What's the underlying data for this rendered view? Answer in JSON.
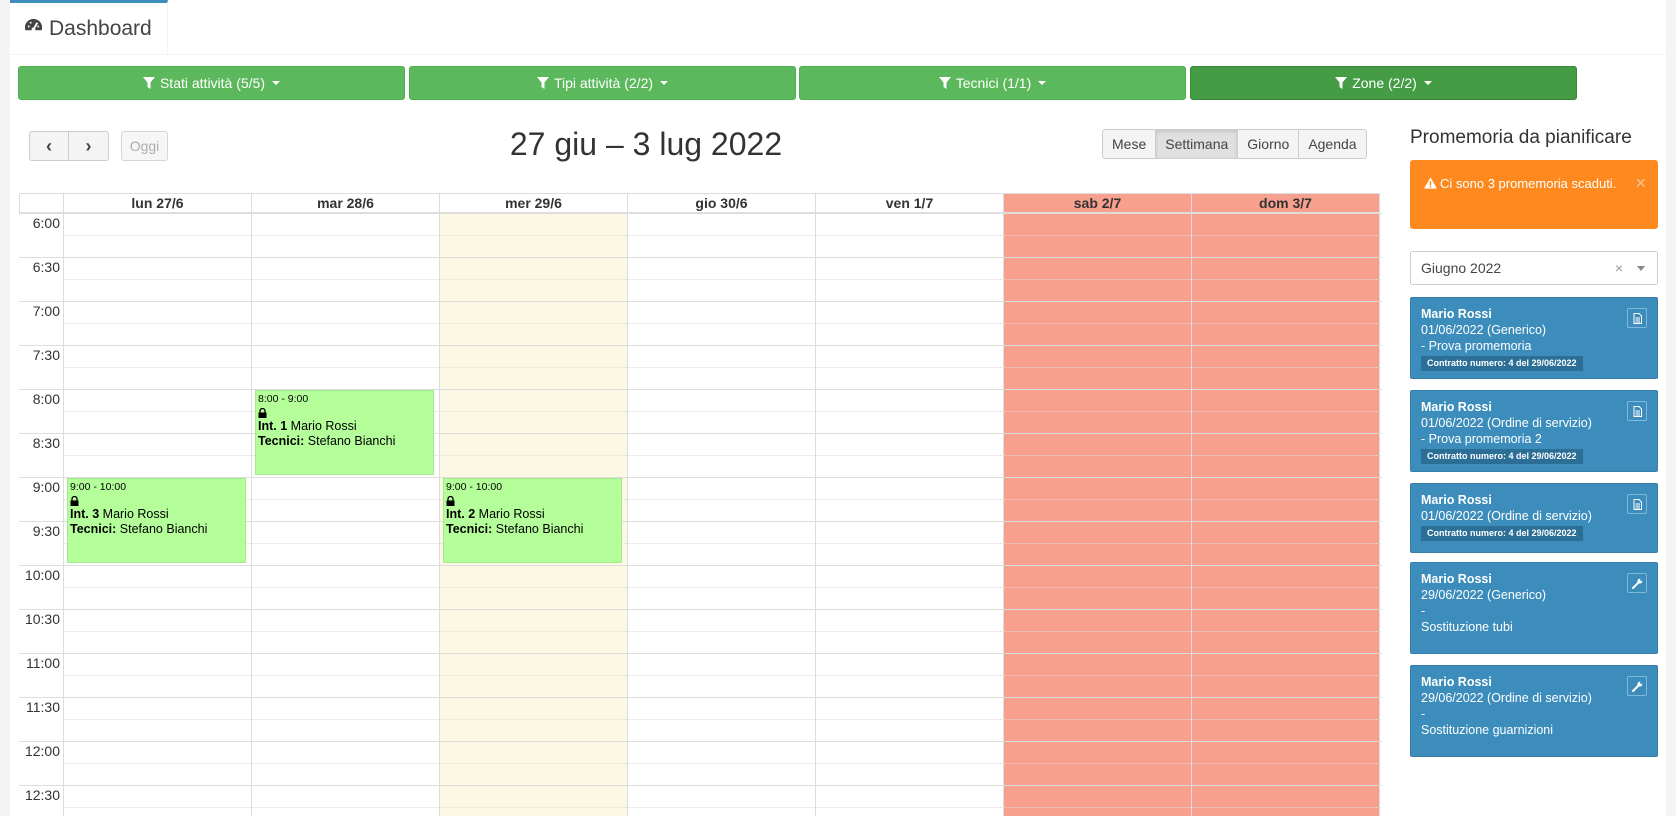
{
  "header": {
    "tab_label": "Dashboard",
    "tab_icon": "dashboard-icon"
  },
  "filters": [
    {
      "label": "Stati attività (5/5)",
      "active": false
    },
    {
      "label": "Tipi attività (2/2)",
      "active": false
    },
    {
      "label": "Tecnici (1/1)",
      "active": false
    },
    {
      "label": "Zone (2/2)",
      "active": true
    }
  ],
  "calendar": {
    "title": "27 giu – 3 lug 2022",
    "prev_label": "‹",
    "next_label": "›",
    "today_label": "Oggi",
    "views": [
      "Mese",
      "Settimana",
      "Giorno",
      "Agenda"
    ],
    "active_view": "Settimana",
    "days": [
      {
        "label": "lun 27/6",
        "type": "normal"
      },
      {
        "label": "mar 28/6",
        "type": "normal"
      },
      {
        "label": "mer 29/6",
        "type": "today"
      },
      {
        "label": "gio 30/6",
        "type": "normal"
      },
      {
        "label": "ven 1/7",
        "type": "normal"
      },
      {
        "label": "sab 2/7",
        "type": "weekend"
      },
      {
        "label": "dom 3/7",
        "type": "weekend"
      }
    ],
    "times": [
      "6:00",
      "6:30",
      "7:00",
      "7:30",
      "8:00",
      "8:30",
      "9:00",
      "9:30",
      "10:00",
      "10:30",
      "11:00",
      "11:30",
      "12:00",
      "12:30"
    ],
    "events": [
      {
        "day": 1,
        "start": "8:00",
        "end": "9:00",
        "time": "8:00 - 9:00",
        "int_label": "Int. 1",
        "client": "Mario Rossi",
        "tech_label": "Tecnici:",
        "tech": "Stefano Bianchi"
      },
      {
        "day": 0,
        "start": "9:00",
        "end": "10:00",
        "time": "9:00 - 10:00",
        "int_label": "Int. 3",
        "client": "Mario Rossi",
        "tech_label": "Tecnici:",
        "tech": "Stefano Bianchi"
      },
      {
        "day": 2,
        "start": "9:00",
        "end": "10:00",
        "time": "9:00 - 10:00",
        "int_label": "Int. 2",
        "client": "Mario Rossi",
        "tech_label": "Tecnici:",
        "tech": "Stefano Bianchi"
      }
    ],
    "colors": {
      "event": "#b5ff9b",
      "today": "#fcf8e3",
      "weekend": "#f8a08e"
    }
  },
  "sidebar": {
    "title": "Promemoria da pianificare",
    "alert_text": "Ci sono 3 promemoria scaduti.",
    "alert_close": "×",
    "month_value": "Giugno 2022",
    "month_clear": "×",
    "reminders": [
      {
        "name": "Mario Rossi",
        "line1": "01/06/2022 (Generico)",
        "line2": "- Prova promemoria",
        "contract": "Contratto numero: 4 del 29/06/2022",
        "icon": "document-icon"
      },
      {
        "name": "Mario Rossi",
        "line1": "01/06/2022 (Ordine di servizio)",
        "line2": "- Prova promemoria 2",
        "contract": "Contratto numero: 4 del 29/06/2022",
        "icon": "document-icon"
      },
      {
        "name": "Mario Rossi",
        "line1": "01/06/2022 (Ordine di servizio)",
        "line2": "",
        "contract": "Contratto numero: 4 del 29/06/2022",
        "icon": "document-icon"
      },
      {
        "name": "Mario Rossi",
        "line1": "29/06/2022 (Generico)",
        "line2": "-",
        "line3": "Sostituzione tubi",
        "contract": "",
        "icon": "wrench-icon"
      },
      {
        "name": "Mario Rossi",
        "line1": "29/06/2022 (Ordine di servizio)",
        "line2": "-",
        "line3": "Sostituzione guarnizioni",
        "contract": "",
        "icon": "wrench-icon"
      }
    ]
  }
}
